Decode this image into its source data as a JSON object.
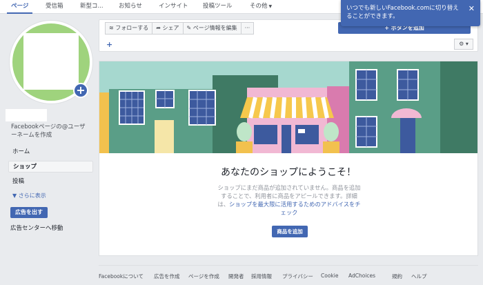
{
  "topnav": {
    "tabs": [
      {
        "label": "ページ",
        "active": true
      },
      {
        "label": "受信箱"
      },
      {
        "label": "新型コ..."
      },
      {
        "label": "お知らせ"
      },
      {
        "label": "インサイト"
      },
      {
        "label": "投稿ツール"
      },
      {
        "label": "その他"
      }
    ]
  },
  "notification": {
    "text": "いつでも新しいFacebook.comに切り替えることができます。",
    "close": "✕"
  },
  "profile": {
    "username_prompt": "Facebookページの@ユーザーネームを作成"
  },
  "sidebar": {
    "items": [
      {
        "label": "ホーム"
      },
      {
        "label": "ショップ",
        "selected": true
      },
      {
        "label": "投稿"
      }
    ],
    "more": "さらに表示",
    "ad_button": "広告を出す",
    "ad_center": "広告センターへ移動"
  },
  "actions": {
    "follow": "フォローする",
    "share": "シェア",
    "edit": "ページ情報を編集",
    "more": "···",
    "add_button": "+ ボタンを追加",
    "plus": "+",
    "settings": "⚙ ▾"
  },
  "shop": {
    "title": "あなたのショップにようこそ！",
    "desc_before": "ショップにまだ商品が追加されていません。商品を追加することで、利用者に商品をアピールできます。詳細は、",
    "desc_link": "ショップを最大限に活用するためのアドバイスをチェック",
    "add_product": "商品を追加"
  },
  "footer": {
    "links": [
      "Facebookについて",
      "広告を作成",
      "ページを作成",
      "開発者",
      "採用情報",
      "プライバシー",
      "Cookie",
      "AdChoices",
      "規約",
      "ヘルプ"
    ]
  },
  "colors": {
    "brand_blue": "#4267b2",
    "avatar_green": "#9fd37d",
    "background": "#e9ebee"
  }
}
